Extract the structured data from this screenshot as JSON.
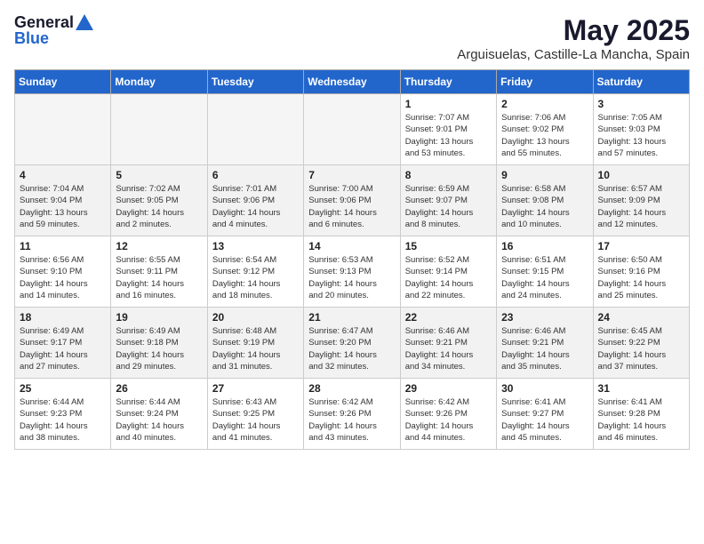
{
  "logo": {
    "general": "General",
    "blue": "Blue"
  },
  "title": {
    "month": "May 2025",
    "location": "Arguisuelas, Castille-La Mancha, Spain"
  },
  "weekdays": [
    "Sunday",
    "Monday",
    "Tuesday",
    "Wednesday",
    "Thursday",
    "Friday",
    "Saturday"
  ],
  "weeks": [
    [
      {
        "day": "",
        "info": "",
        "empty": true
      },
      {
        "day": "",
        "info": "",
        "empty": true
      },
      {
        "day": "",
        "info": "",
        "empty": true
      },
      {
        "day": "",
        "info": "",
        "empty": true
      },
      {
        "day": "1",
        "info": "Sunrise: 7:07 AM\nSunset: 9:01 PM\nDaylight: 13 hours\nand 53 minutes."
      },
      {
        "day": "2",
        "info": "Sunrise: 7:06 AM\nSunset: 9:02 PM\nDaylight: 13 hours\nand 55 minutes."
      },
      {
        "day": "3",
        "info": "Sunrise: 7:05 AM\nSunset: 9:03 PM\nDaylight: 13 hours\nand 57 minutes."
      }
    ],
    [
      {
        "day": "4",
        "info": "Sunrise: 7:04 AM\nSunset: 9:04 PM\nDaylight: 13 hours\nand 59 minutes."
      },
      {
        "day": "5",
        "info": "Sunrise: 7:02 AM\nSunset: 9:05 PM\nDaylight: 14 hours\nand 2 minutes."
      },
      {
        "day": "6",
        "info": "Sunrise: 7:01 AM\nSunset: 9:06 PM\nDaylight: 14 hours\nand 4 minutes."
      },
      {
        "day": "7",
        "info": "Sunrise: 7:00 AM\nSunset: 9:06 PM\nDaylight: 14 hours\nand 6 minutes."
      },
      {
        "day": "8",
        "info": "Sunrise: 6:59 AM\nSunset: 9:07 PM\nDaylight: 14 hours\nand 8 minutes."
      },
      {
        "day": "9",
        "info": "Sunrise: 6:58 AM\nSunset: 9:08 PM\nDaylight: 14 hours\nand 10 minutes."
      },
      {
        "day": "10",
        "info": "Sunrise: 6:57 AM\nSunset: 9:09 PM\nDaylight: 14 hours\nand 12 minutes."
      }
    ],
    [
      {
        "day": "11",
        "info": "Sunrise: 6:56 AM\nSunset: 9:10 PM\nDaylight: 14 hours\nand 14 minutes."
      },
      {
        "day": "12",
        "info": "Sunrise: 6:55 AM\nSunset: 9:11 PM\nDaylight: 14 hours\nand 16 minutes."
      },
      {
        "day": "13",
        "info": "Sunrise: 6:54 AM\nSunset: 9:12 PM\nDaylight: 14 hours\nand 18 minutes."
      },
      {
        "day": "14",
        "info": "Sunrise: 6:53 AM\nSunset: 9:13 PM\nDaylight: 14 hours\nand 20 minutes."
      },
      {
        "day": "15",
        "info": "Sunrise: 6:52 AM\nSunset: 9:14 PM\nDaylight: 14 hours\nand 22 minutes."
      },
      {
        "day": "16",
        "info": "Sunrise: 6:51 AM\nSunset: 9:15 PM\nDaylight: 14 hours\nand 24 minutes."
      },
      {
        "day": "17",
        "info": "Sunrise: 6:50 AM\nSunset: 9:16 PM\nDaylight: 14 hours\nand 25 minutes."
      }
    ],
    [
      {
        "day": "18",
        "info": "Sunrise: 6:49 AM\nSunset: 9:17 PM\nDaylight: 14 hours\nand 27 minutes."
      },
      {
        "day": "19",
        "info": "Sunrise: 6:49 AM\nSunset: 9:18 PM\nDaylight: 14 hours\nand 29 minutes."
      },
      {
        "day": "20",
        "info": "Sunrise: 6:48 AM\nSunset: 9:19 PM\nDaylight: 14 hours\nand 31 minutes."
      },
      {
        "day": "21",
        "info": "Sunrise: 6:47 AM\nSunset: 9:20 PM\nDaylight: 14 hours\nand 32 minutes."
      },
      {
        "day": "22",
        "info": "Sunrise: 6:46 AM\nSunset: 9:21 PM\nDaylight: 14 hours\nand 34 minutes."
      },
      {
        "day": "23",
        "info": "Sunrise: 6:46 AM\nSunset: 9:21 PM\nDaylight: 14 hours\nand 35 minutes."
      },
      {
        "day": "24",
        "info": "Sunrise: 6:45 AM\nSunset: 9:22 PM\nDaylight: 14 hours\nand 37 minutes."
      }
    ],
    [
      {
        "day": "25",
        "info": "Sunrise: 6:44 AM\nSunset: 9:23 PM\nDaylight: 14 hours\nand 38 minutes."
      },
      {
        "day": "26",
        "info": "Sunrise: 6:44 AM\nSunset: 9:24 PM\nDaylight: 14 hours\nand 40 minutes."
      },
      {
        "day": "27",
        "info": "Sunrise: 6:43 AM\nSunset: 9:25 PM\nDaylight: 14 hours\nand 41 minutes."
      },
      {
        "day": "28",
        "info": "Sunrise: 6:42 AM\nSunset: 9:26 PM\nDaylight: 14 hours\nand 43 minutes."
      },
      {
        "day": "29",
        "info": "Sunrise: 6:42 AM\nSunset: 9:26 PM\nDaylight: 14 hours\nand 44 minutes."
      },
      {
        "day": "30",
        "info": "Sunrise: 6:41 AM\nSunset: 9:27 PM\nDaylight: 14 hours\nand 45 minutes."
      },
      {
        "day": "31",
        "info": "Sunrise: 6:41 AM\nSunset: 9:28 PM\nDaylight: 14 hours\nand 46 minutes."
      }
    ]
  ]
}
